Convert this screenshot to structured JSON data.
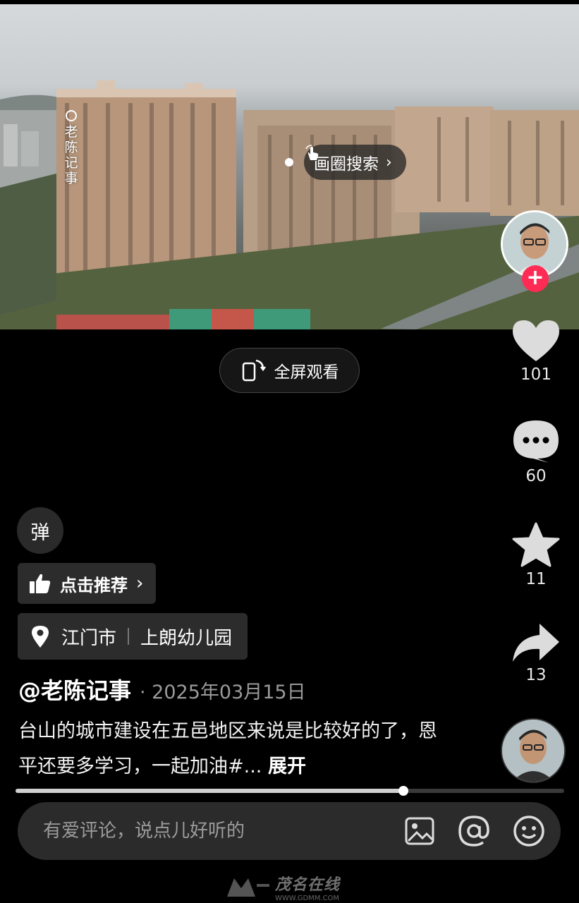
{
  "video": {
    "watermark": "老陈记事",
    "circle_search_label": "画圈搜索",
    "fullscreen_label": "全屏观看"
  },
  "actions": {
    "like_count": "101",
    "comment_count": "60",
    "favorite_count": "11",
    "share_count": "13"
  },
  "danmu_label": "弹",
  "recommend_label": "点击推荐",
  "location": {
    "city": "江门市",
    "place": "上朗幼儿园"
  },
  "post": {
    "author": "@老陈记事",
    "date": "· 2025年03月15日",
    "caption": "台山的城市建设在五邑地区来说是比较好的了，恩平还要多学习，一起加油#...",
    "expand_label": "展开"
  },
  "progress": {
    "played_fraction": 0.707
  },
  "comment_bar": {
    "placeholder": "有爱评论，说点儿好听的"
  },
  "icons": [
    "hand-pointer-icon",
    "chevron-right-icon",
    "rotate-screen-icon",
    "heart-icon",
    "comment-bubble-icon",
    "star-icon",
    "share-arrow-icon",
    "thumbs-up-icon",
    "location-pin-icon",
    "image-icon",
    "at-icon",
    "emoji-icon",
    "plus-icon"
  ],
  "footer": {
    "brand": "茂名在线",
    "url": "WWW.GDMM.COM"
  },
  "colors": {
    "accent": "#fe2c55",
    "background": "#000000",
    "panel": "#2c2c2c"
  }
}
